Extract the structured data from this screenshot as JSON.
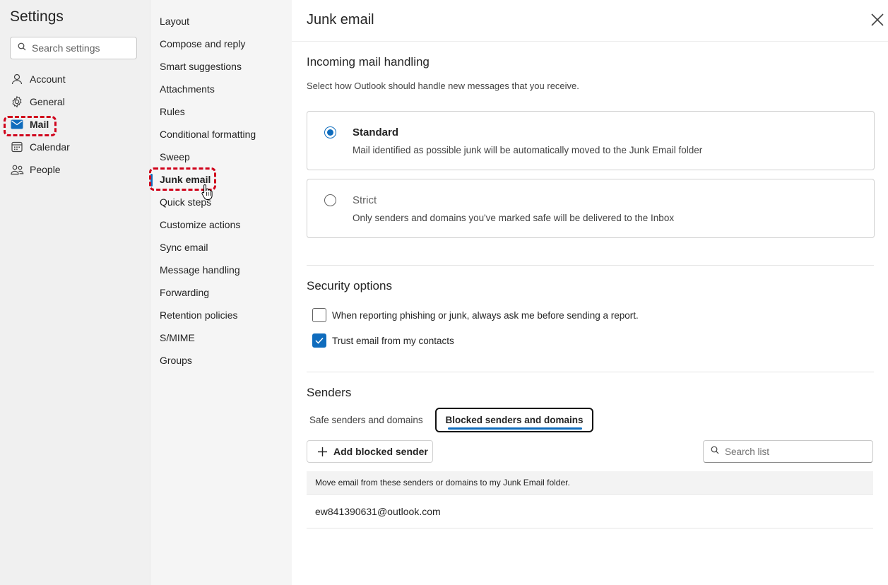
{
  "sidebar": {
    "title": "Settings",
    "search_placeholder": "Search settings",
    "items": [
      {
        "label": "Account",
        "icon": "person-icon"
      },
      {
        "label": "General",
        "icon": "gear-icon"
      },
      {
        "label": "Mail",
        "icon": "mail-icon",
        "active": true
      },
      {
        "label": "Calendar",
        "icon": "calendar-icon"
      },
      {
        "label": "People",
        "icon": "people-icon"
      }
    ]
  },
  "submenu": {
    "items": [
      "Layout",
      "Compose and reply",
      "Smart suggestions",
      "Attachments",
      "Rules",
      "Conditional formatting",
      "Sweep",
      "Junk email",
      "Quick steps",
      "Customize actions",
      "Sync email",
      "Message handling",
      "Forwarding",
      "Retention policies",
      "S/MIME",
      "Groups"
    ],
    "active": "Junk email"
  },
  "main": {
    "title": "Junk email",
    "incoming": {
      "title": "Incoming mail handling",
      "description": "Select how Outlook should handle new messages that you receive.",
      "options": [
        {
          "title": "Standard",
          "description": "Mail identified as possible junk will be automatically moved to the Junk Email folder",
          "selected": true
        },
        {
          "title": "Strict",
          "description": "Only senders and domains you've marked safe will be delivered to the Inbox",
          "selected": false
        }
      ]
    },
    "security": {
      "title": "Security options",
      "options": [
        {
          "label": "When reporting phishing or junk, always ask me before sending a report.",
          "checked": false
        },
        {
          "label": "Trust email from my contacts",
          "checked": true
        }
      ]
    },
    "senders": {
      "title": "Senders",
      "tabs": [
        {
          "label": "Safe senders and domains",
          "selected": false
        },
        {
          "label": "Blocked senders and domains",
          "selected": true
        }
      ],
      "add_button": "Add blocked sender",
      "search_placeholder": "Search list",
      "list_header": "Move email from these senders or domains to my Junk Email folder.",
      "entries": [
        "ew841390631@outlook.com"
      ]
    }
  },
  "colors": {
    "accent": "#0f6cbd",
    "highlight_dash": "#d0021b"
  }
}
